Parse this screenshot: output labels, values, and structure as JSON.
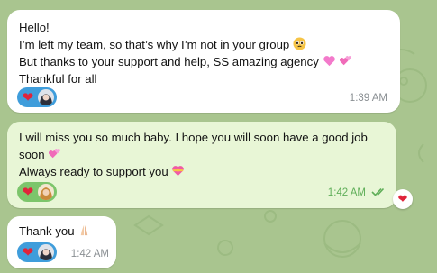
{
  "messages": [
    {
      "lines": [
        "Hello!",
        "I’m left my team, so that’s why I’m not in your group",
        "But thanks to your support and help, SS amazing agency",
        "Thankful for all"
      ],
      "time": "1:39 AM"
    },
    {
      "lines": [
        "I will miss you so much baby. I hope you will soon have a good job",
        "soon",
        "Always ready to support you"
      ],
      "time": "1:42 AM"
    },
    {
      "lines": [
        "Thank you"
      ],
      "time": "1:42 AM"
    }
  ],
  "icons": {
    "heart": "heart-icon",
    "check": "double-check-icon"
  },
  "colors": {
    "background": "#a9c58f",
    "incoming_bubble": "#ffffff",
    "outgoing_bubble": "#e8f6d6",
    "accent_blue": "#3f9ddb",
    "accent_green": "#5fae58"
  }
}
